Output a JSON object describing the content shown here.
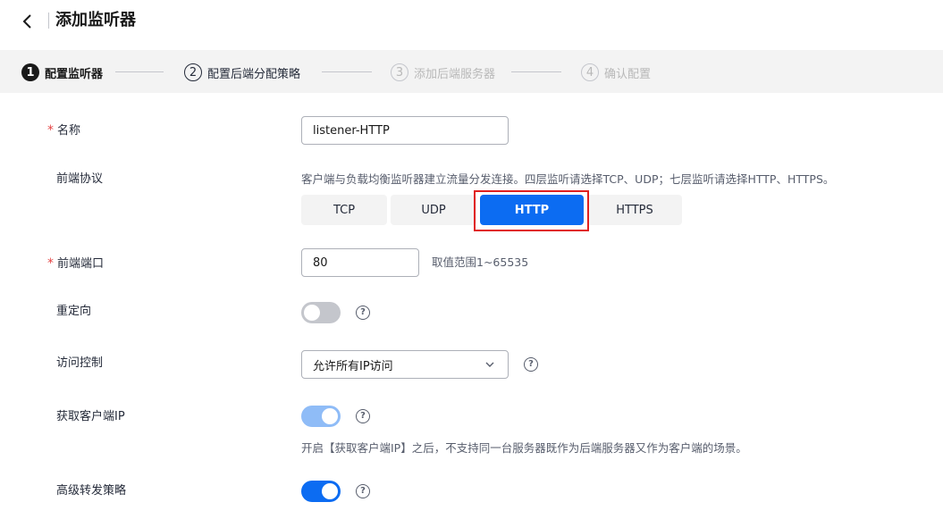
{
  "header": {
    "title": "添加监听器"
  },
  "steps": [
    {
      "num": "1",
      "label": "配置监听器",
      "state": "active"
    },
    {
      "num": "2",
      "label": "配置后端分配策略",
      "state": "normal"
    },
    {
      "num": "3",
      "label": "添加后端服务器",
      "state": "disabled"
    },
    {
      "num": "4",
      "label": "确认配置",
      "state": "disabled"
    }
  ],
  "form": {
    "name": {
      "label": "名称",
      "value": "listener-HTTP",
      "required": true
    },
    "protocol": {
      "label": "前端协议",
      "hint": "客户端与负载均衡监听器建立流量分发连接。四层监听请选择TCP、UDP；七层监听请选择HTTP、HTTPS。",
      "options": [
        "TCP",
        "UDP",
        "HTTP",
        "HTTPS"
      ],
      "selected": "HTTP"
    },
    "port": {
      "label": "前端端口",
      "value": "80",
      "hint": "取值范围1~65535",
      "required": true
    },
    "redirect": {
      "label": "重定向",
      "enabled": false
    },
    "access_control": {
      "label": "访问控制",
      "value": "允许所有IP访问"
    },
    "client_ip": {
      "label": "获取客户端IP",
      "enabled": true,
      "disabled": true,
      "hint": "开启【获取客户端IP】之后，不支持同一台服务器既作为后端服务器又作为客户端的场景。"
    },
    "advanced_policy": {
      "label": "高级转发策略",
      "enabled": true
    }
  },
  "icons": {
    "back": "chevron-left-icon",
    "help": "question-circle-icon",
    "dropdown": "chevron-down-icon"
  },
  "colors": {
    "accent": "#0c6cf2",
    "required": "#e54545",
    "highlight": "#e02020"
  }
}
